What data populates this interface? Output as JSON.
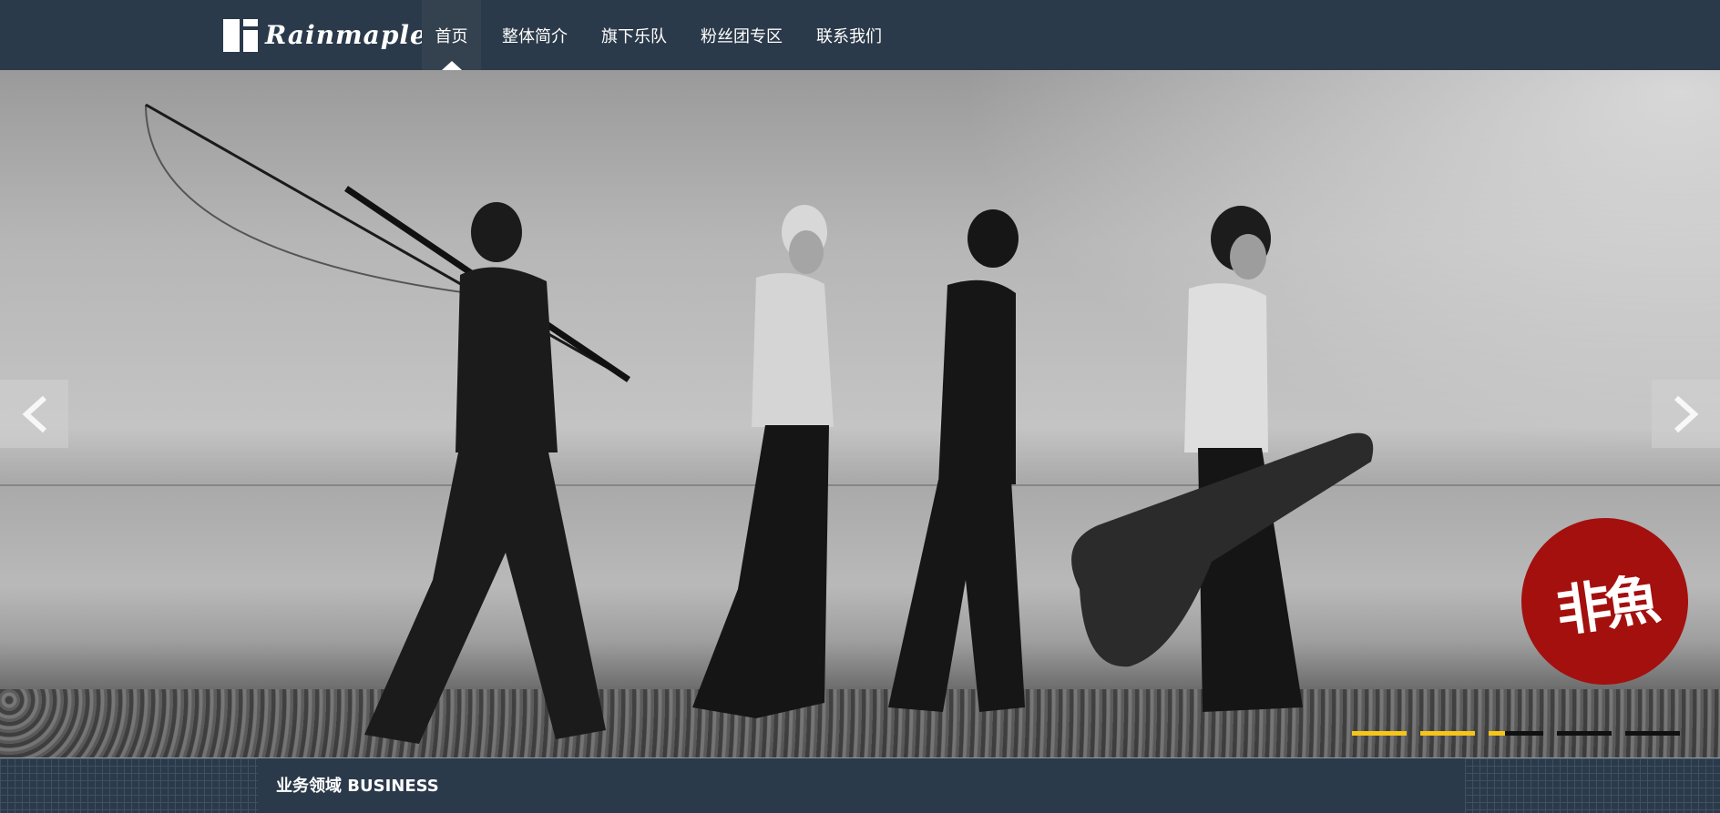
{
  "header": {
    "logo_text": "Rainmaple",
    "nav": [
      {
        "label": "首页",
        "active": true
      },
      {
        "label": "整体简介",
        "active": false
      },
      {
        "label": "旗下乐队",
        "active": false
      },
      {
        "label": "粉丝团专区",
        "active": false
      },
      {
        "label": "联系我们",
        "active": false
      }
    ]
  },
  "hero": {
    "badge_text": "非魚",
    "prev_icon": "chevron-left-icon",
    "next_icon": "chevron-right-icon",
    "slides": [
      {
        "progress": 1.0
      },
      {
        "progress": 1.0
      },
      {
        "progress": 0.3
      },
      {
        "progress": 0.0
      },
      {
        "progress": 0.0
      }
    ]
  },
  "business": {
    "title": "业务领域 BUSINESS"
  },
  "colors": {
    "nav_bg": "#2b3a4a",
    "accent": "#f5c518",
    "badge": "#a4100e"
  }
}
